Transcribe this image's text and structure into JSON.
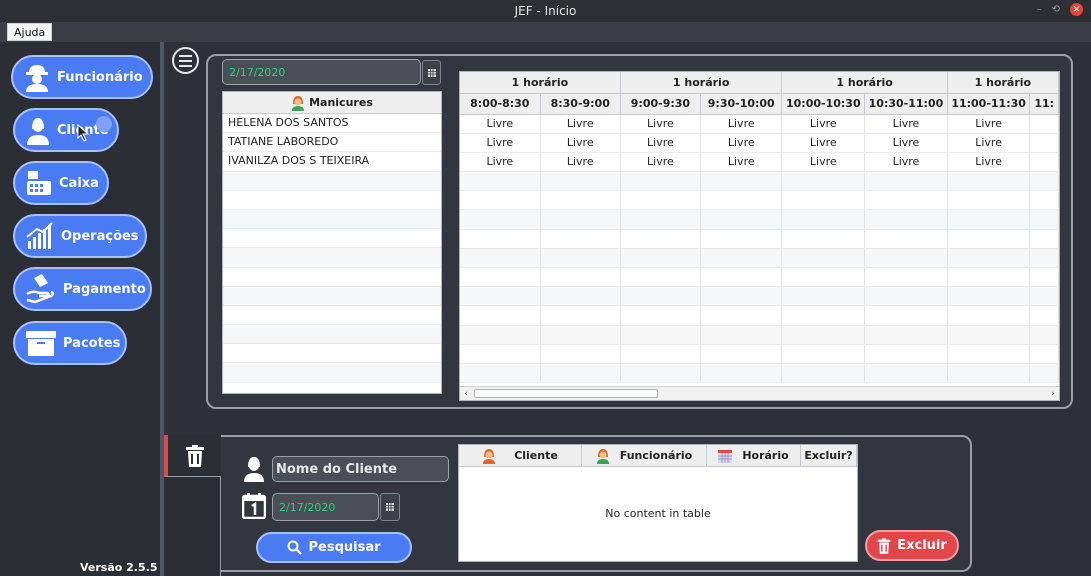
{
  "window": {
    "title": "JEF - Início",
    "minimize": "–",
    "restore": "⟲",
    "close": "✕"
  },
  "menu": {
    "help": "Ajuda"
  },
  "sidebar": {
    "items": [
      {
        "label": "Funcionário",
        "icon": "worker-icon"
      },
      {
        "label": "Cliente",
        "icon": "client-icon"
      },
      {
        "label": "Caixa",
        "icon": "cash-register-icon"
      },
      {
        "label": "Operações",
        "icon": "chart-growth-icon"
      },
      {
        "label": "Pagamento",
        "icon": "payment-hand-icon"
      },
      {
        "label": "Pacotes",
        "icon": "package-box-icon"
      }
    ],
    "version": "Versão 2.5.5"
  },
  "schedule": {
    "date": "2/17/2020",
    "manicures_header": "Manicures",
    "manicures": [
      "HELENA DOS SANTOS",
      "TATIANE LABOREDO",
      "IVANILZA DOS S TEIXEIRA"
    ],
    "group_headers": [
      "1 horário",
      "1 horário",
      "1 horário",
      "1 horário"
    ],
    "slots": [
      "8:00-8:30",
      "8:30-9:00",
      "9:00-9:30",
      "9:30-10:00",
      "10:00-10:30",
      "10:30-11:00",
      "11:00-11:30",
      "11:"
    ],
    "rows": [
      [
        "Livre",
        "Livre",
        "Livre",
        "Livre",
        "Livre",
        "Livre",
        "Livre",
        ""
      ],
      [
        "Livre",
        "Livre",
        "Livre",
        "Livre",
        "Livre",
        "Livre",
        "Livre",
        ""
      ],
      [
        "Livre",
        "Livre",
        "Livre",
        "Livre",
        "Livre",
        "Livre",
        "Livre",
        ""
      ]
    ]
  },
  "delete_panel": {
    "client_name_placeholder": "Nome do Cliente",
    "date": "2/17/2020",
    "search_label": "Pesquisar",
    "columns": [
      "Cliente",
      "Funcionário",
      "Horário",
      "Excluir?"
    ],
    "empty_message": "No content in table",
    "delete_label": "Excluir"
  },
  "colors": {
    "accent": "#4b7bf2",
    "danger": "#e2464a",
    "date_text": "#35d07a"
  }
}
